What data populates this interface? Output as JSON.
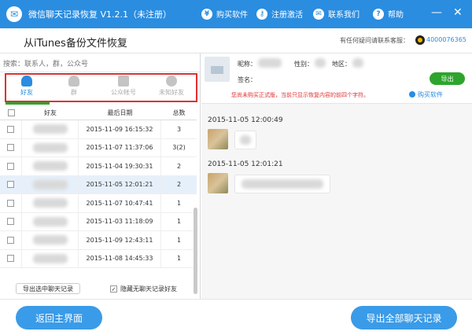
{
  "app": {
    "title": "微信聊天记录恢复 V1.2.1（未注册）"
  },
  "toolbar": {
    "buy": "购买软件",
    "register": "注册激活",
    "contact": "联系我们",
    "help": "帮助"
  },
  "window": {
    "minimize": "—",
    "close": "✕"
  },
  "header": {
    "subtitle": "从iTunes备份文件恢复",
    "support_label": "有任何疑问请联系客服：",
    "support_qq": "4000076365"
  },
  "search": {
    "placeholder": "搜索：联系人，群，公众号"
  },
  "categories": [
    {
      "label": "好友",
      "active": true
    },
    {
      "label": "群",
      "active": false
    },
    {
      "label": "公众帐号",
      "active": false
    },
    {
      "label": "未知好友",
      "active": false
    }
  ],
  "table": {
    "headers": [
      "好友",
      "最后日期",
      "总数"
    ],
    "rows": [
      {
        "date": "2015-11-09 16:15:32",
        "count": "3"
      },
      {
        "date": "2015-11-07 11:37:06",
        "count": "3(2)"
      },
      {
        "date": "2015-11-04 19:30:31",
        "count": "2"
      },
      {
        "date": "2015-11-05 12:01:21",
        "count": "2",
        "selected": true
      },
      {
        "date": "2015-11-07 10:47:41",
        "count": "1"
      },
      {
        "date": "2015-11-03 11:18:09",
        "count": "1"
      },
      {
        "date": "2015-11-09 12:43:11",
        "count": "1"
      },
      {
        "date": "2015-11-08 14:45:33",
        "count": "1"
      }
    ]
  },
  "left_footer": {
    "export_selected": "导出选中聊天记录",
    "hide_empty": "隐藏无聊天记录好友",
    "hide_checked": "✓"
  },
  "profile": {
    "nickname_label": "昵称：",
    "gender_label": "性别：",
    "region_label": "地区：",
    "signature_label": "签名：",
    "export": "导出"
  },
  "notice": {
    "text": "您尚未购买正式版，当前只显示恢复内容的前四个字符。",
    "buy": "购买软件"
  },
  "chat": [
    {
      "time": "2015-11-05 12:00:49"
    },
    {
      "time": "2015-11-05 12:01:21"
    }
  ],
  "bottom": {
    "back": "返回主界面",
    "export_all": "导出全部聊天记录"
  },
  "colors": {
    "titlebar": "#2a8de0",
    "accent_green": "#2da42d",
    "notice_red": "#e03030",
    "button_blue": "#3a9be8"
  }
}
